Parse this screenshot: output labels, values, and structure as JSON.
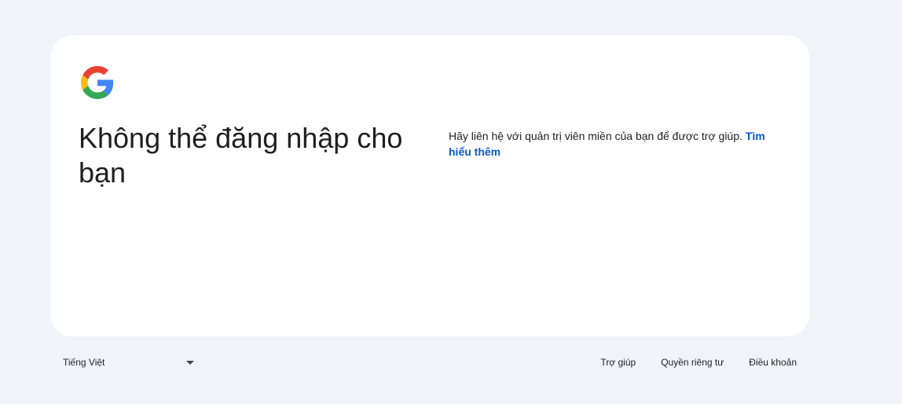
{
  "brand": {
    "logo_icon": "google-g-logo-icon",
    "colors": {
      "blue": "#4285F4",
      "red": "#EA4335",
      "yellow": "#FBBC05",
      "green": "#34A853"
    }
  },
  "main": {
    "title": "Không thể đăng nhập cho bạn",
    "message": "Hãy liên hệ với quản trị viên miền của bạn để được trợ giúp.",
    "learn_more_label": "Tìm hiểu thêm"
  },
  "footer": {
    "language": {
      "selected": "Tiếng Việt",
      "icon": "caret-down-icon"
    },
    "links": {
      "help": "Trợ giúp",
      "privacy": "Quyền riêng tư",
      "terms": "Điều khoản"
    }
  },
  "colors": {
    "page_background": "#f0f4f9",
    "card_background": "#ffffff",
    "link": "#0b57d0",
    "text": "#1f1f1f"
  }
}
